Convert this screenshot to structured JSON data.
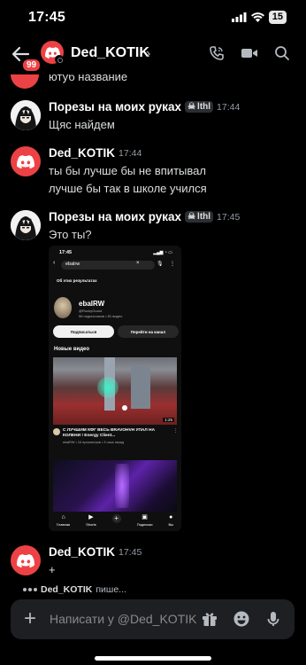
{
  "status_bar": {
    "time": "17:45",
    "battery": "15"
  },
  "header": {
    "back_badge": "99",
    "title": "Ded_KOTIK",
    "chevron": "›"
  },
  "colors": {
    "accent": "#ed4245",
    "background": "#000000",
    "composer_bg": "#1e1f22"
  },
  "messages": {
    "top_text": "ютуб название",
    "m1": {
      "author": "Порезы на моих руках",
      "tag": "lthl",
      "time": "17:44",
      "lines": [
        "Щяс найдем"
      ]
    },
    "m2": {
      "author": "Ded_KOTIK",
      "time": "17:44",
      "lines": [
        "ты бы лучше бы не впитывал",
        "лучше бы так в школе учился"
      ]
    },
    "m3": {
      "author": "Порезы на моих руках",
      "tag": "lthl",
      "time": "17:45",
      "lines": [
        "Это ты?"
      ]
    },
    "m4": {
      "author": "Ded_KOTIK",
      "time": "17:45",
      "lines": [
        "+"
      ]
    }
  },
  "attachment": {
    "time": "17:45",
    "search_query": "ebalrw",
    "about_label": "Об этих результатах",
    "channel_name": "ebalRW",
    "channel_handle": "@RockyGuard",
    "channel_stats": "56 подписчиков • 81 видео",
    "subscribe_label": "Подписаться",
    "go_channel_label": "Перейти на канал",
    "new_videos_label": "Новые видео",
    "video_duration": "1:25",
    "video_title": "С ЛУЧШИМ КФГ ВЕСЬ BRAVOHVH УПАЛ НА КОЛЕНИ ! Energy Client...",
    "video_meta": "ebalRW • 16 просмотров • 3 часа назад",
    "nav": [
      "Главная",
      "Shorts",
      "",
      "Подписки",
      "Вы"
    ]
  },
  "typing": {
    "user": "Ded_KOTIK",
    "suffix": "пише..."
  },
  "composer": {
    "placeholder": "Написати у @Ded_KOTIK"
  },
  "icons": [
    "back-arrow-icon",
    "discord-logo-icon",
    "phone-icon",
    "video-camera-icon",
    "search-icon",
    "plus-icon",
    "gift-icon",
    "emoji-icon",
    "microphone-icon",
    "skull-icon"
  ]
}
